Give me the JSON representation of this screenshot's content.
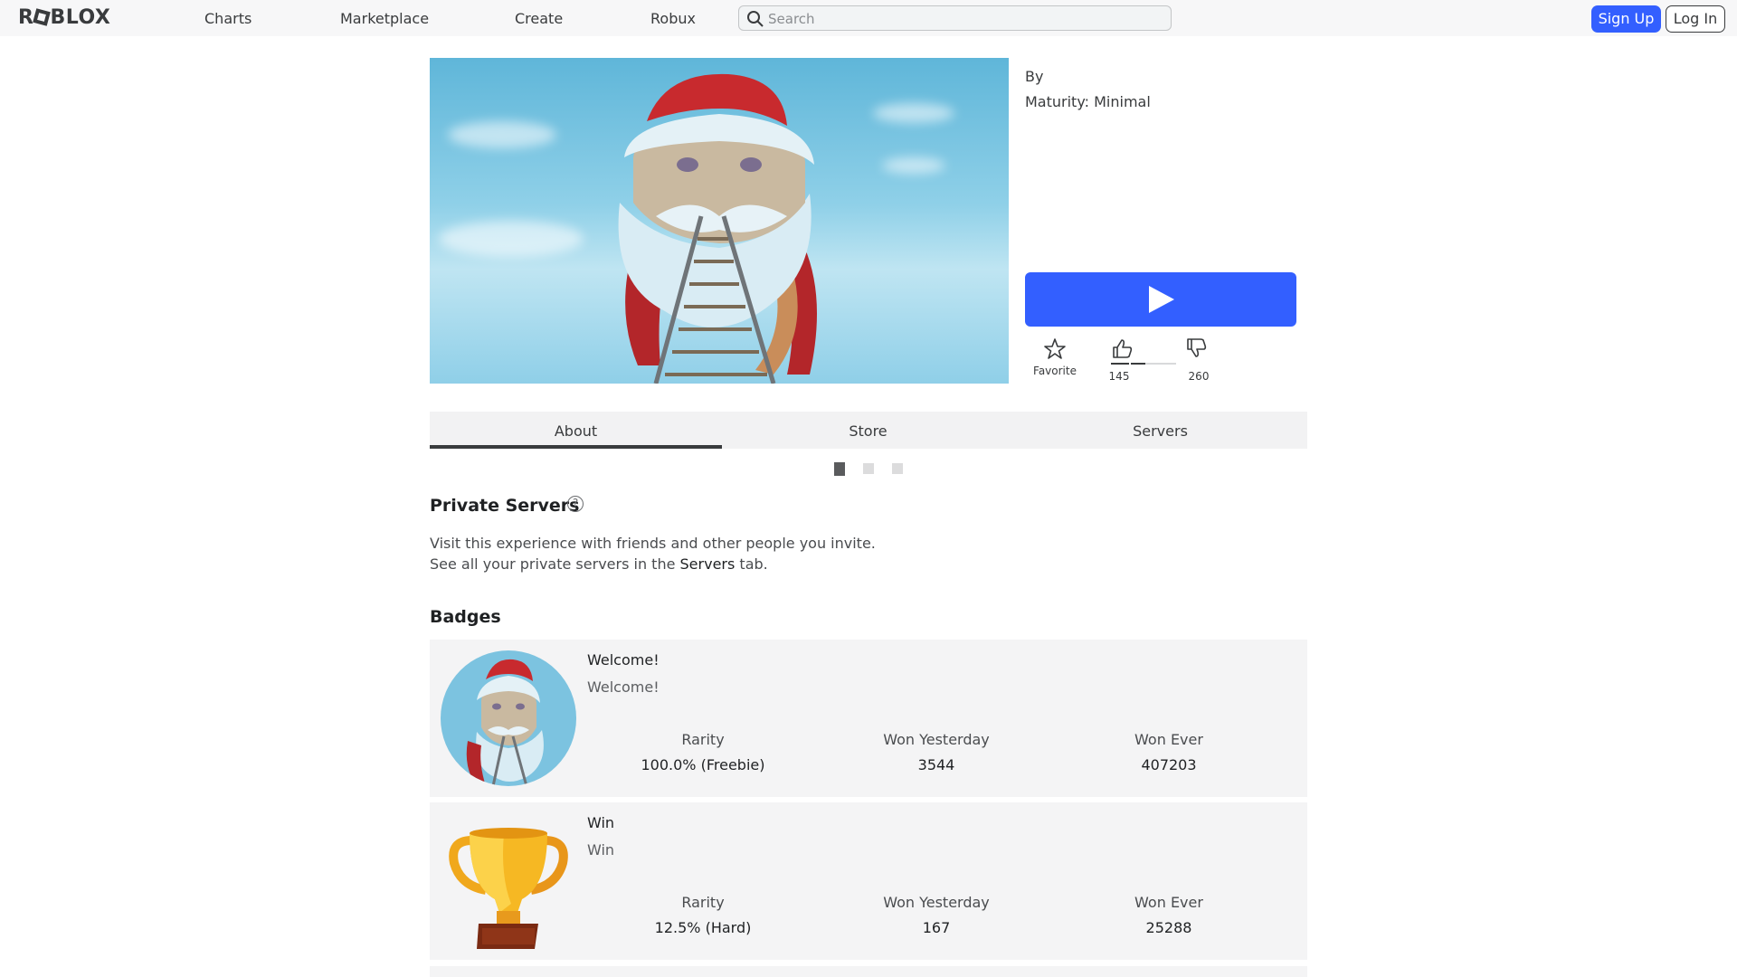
{
  "header": {
    "logo": "ROBLOX",
    "nav": [
      "Charts",
      "Marketplace",
      "Create",
      "Robux"
    ],
    "search_placeholder": "Search",
    "signup": "Sign Up",
    "login": "Log In"
  },
  "game": {
    "by_label": "By",
    "maturity": "Maturity: Minimal",
    "favorite_label": "Favorite",
    "upvotes": "145",
    "downvotes": "260"
  },
  "tabs": [
    "About",
    "Store",
    "Servers"
  ],
  "private_servers": {
    "title": "Private Servers",
    "line1": "Visit this experience with friends and other people you invite.",
    "line2_pre": "See all your private servers in the ",
    "line2_link": "Servers",
    "line2_post": " tab."
  },
  "badges": {
    "title": "Badges",
    "stat_labels": [
      "Rarity",
      "Won Yesterday",
      "Won Ever"
    ],
    "items": [
      {
        "name": "Welcome!",
        "description": "Welcome!",
        "rarity": "100.0% (Freebie)",
        "won_yesterday": "3544",
        "won_ever": "407203"
      },
      {
        "name": "Win",
        "description": "Win",
        "rarity": "12.5% (Hard)",
        "won_yesterday": "167",
        "won_ever": "25288"
      }
    ]
  },
  "colors": {
    "accent": "#335fff",
    "header_bg": "#f7f7f8",
    "card_bg": "#f4f4f5"
  }
}
